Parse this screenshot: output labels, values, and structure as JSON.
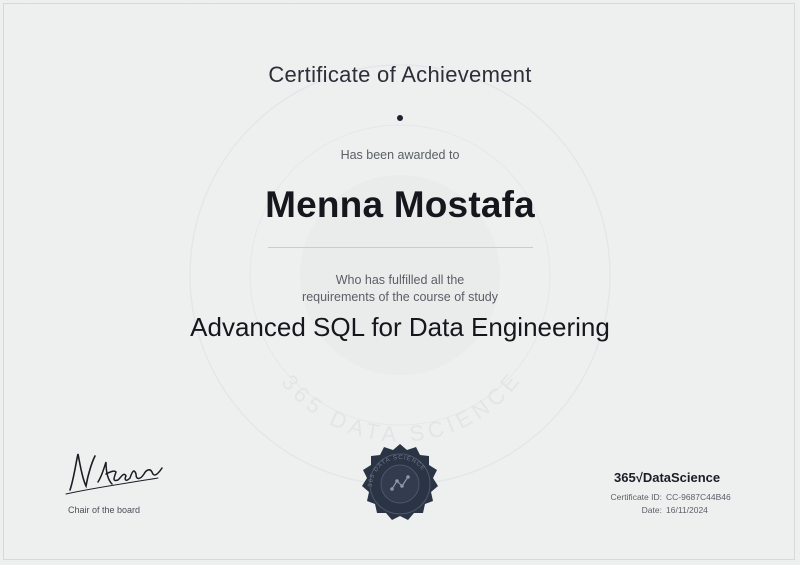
{
  "certificate": {
    "title": "Certificate of Achievement",
    "awarded_text": "Has been awarded to",
    "recipient": "Menna Mostafa",
    "fulfilled_line1": "Who has fulfilled all the",
    "fulfilled_line2": "requirements of the course of study",
    "course": "Advanced SQL for Data Engineering"
  },
  "signature": {
    "name": "N.Krastev",
    "role": "Chair of the board"
  },
  "seal": {
    "text": "365 DATA SCIENCE"
  },
  "watermark": {
    "text": "365 DATA SCIENCE"
  },
  "brand": {
    "logo_text": "365√DataScience"
  },
  "meta": {
    "id_label": "Certificate ID:",
    "id_value": "CC-9687C44B46",
    "date_label": "Date:",
    "date_value": "16/11/2024"
  },
  "colors": {
    "background": "#eef0f0",
    "seal": "#2b3444",
    "text": "#14171c"
  }
}
